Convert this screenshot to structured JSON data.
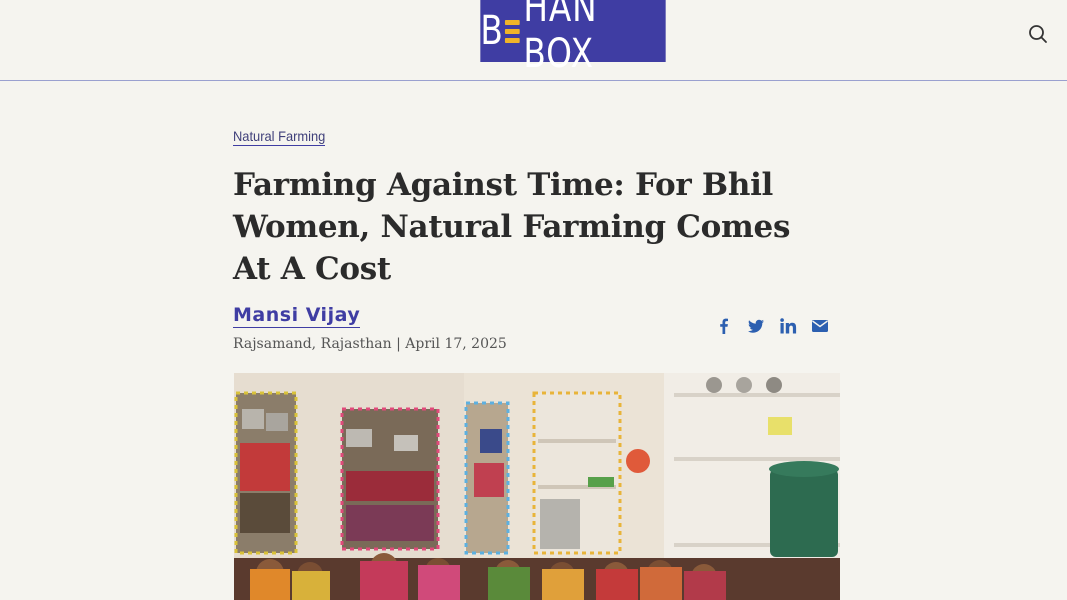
{
  "header": {
    "logo_text_left": "B",
    "logo_text_right": "HAN BOX",
    "logo_alt": "BEHAN BOX"
  },
  "article": {
    "category": "Natural Farming",
    "title": "Farming Against Time: For Bhil Women, Natural Farming Comes At A Cost",
    "author": "Mansi Vijay",
    "location": "Rajsamand, Rajasthan",
    "separator": "|",
    "date": "April 17, 2025"
  },
  "share": {
    "icons": [
      "facebook-icon",
      "twitter-icon",
      "linkedin-icon",
      "email-icon"
    ]
  },
  "colors": {
    "brand": "#3f3da3",
    "brand_accent": "#f0b429",
    "share": "#2c5fb0",
    "background": "#f5f4ef"
  }
}
